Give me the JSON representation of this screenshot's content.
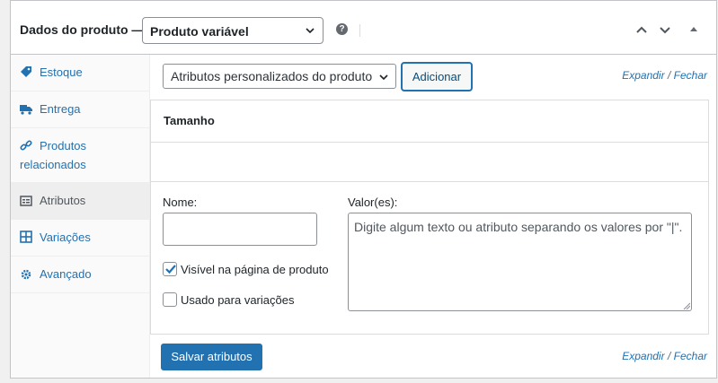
{
  "header": {
    "title": "Dados do produto —",
    "product_type": "Produto variável",
    "help_icon": "?"
  },
  "sidebar": {
    "items": [
      {
        "label": "Estoque",
        "icon": "tag-icon",
        "active": false
      },
      {
        "label": "Entrega",
        "icon": "truck-icon",
        "active": false
      },
      {
        "label_line1": "Produtos",
        "label_line2": "relacionados",
        "icon": "link-icon",
        "active": false
      },
      {
        "label": "Atributos",
        "icon": "list-icon",
        "active": true
      },
      {
        "label": "Variações",
        "icon": "grid-icon",
        "active": false
      },
      {
        "label": "Avançado",
        "icon": "gear-icon",
        "active": false
      }
    ]
  },
  "toolbar": {
    "attribute_select": "Atributos personalizados do produto",
    "add_label": "Adicionar",
    "expand": "Expandir",
    "separator": "/",
    "close": "Fechar"
  },
  "attribute": {
    "name_heading": "Tamanho",
    "name_label": "Nome:",
    "name_value": "",
    "values_label": "Valor(es):",
    "values_placeholder": "Digite algum texto ou atributo separando os valores por \"|\".",
    "visible_label": "Visível na página de produto",
    "visible_checked": true,
    "variations_label": "Usado para variações",
    "variations_checked": false
  },
  "footer": {
    "save_label": "Salvar atributos",
    "expand": "Expandir",
    "separator": "/",
    "close": "Fechar"
  },
  "colors": {
    "link": "#2271b1",
    "primary_button": "#2271b1",
    "border": "#c3c4c7"
  }
}
